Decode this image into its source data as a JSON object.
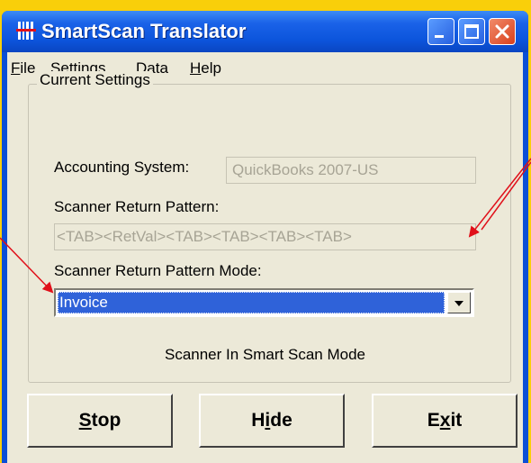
{
  "window": {
    "title": "SmartScan Translator",
    "accent": "#0b4fd6",
    "close_color": "#d9401d"
  },
  "menu": [
    {
      "label": "File",
      "mnemonic": "F",
      "rest": "ile"
    },
    {
      "label": "Settings",
      "pre": "S",
      "mnemonic": "e",
      "rest": "ttings"
    },
    {
      "label": "Data",
      "mnemonic": "D",
      "rest": "ata"
    },
    {
      "label": "Help",
      "mnemonic": "H",
      "rest": "elp"
    }
  ],
  "settings": {
    "group_title": "Current Settings",
    "accounting_label": "Accounting System:",
    "accounting_value": "QuickBooks 2007-US",
    "pattern_label": "Scanner Return Pattern:",
    "pattern_value": "<TAB><RetVal><TAB><TAB><TAB><TAB>",
    "mode_label": "Scanner Return Pattern Mode:",
    "mode_value": "Invoice",
    "status": "Scanner In Smart Scan Mode"
  },
  "buttons": {
    "stop": {
      "mnemonic": "S",
      "rest": "top"
    },
    "hide": {
      "pre": "H",
      "mnemonic": "i",
      "rest": "de"
    },
    "exit": {
      "pre": "E",
      "mnemonic": "x",
      "rest": "it"
    }
  },
  "annotation_color": "#e0101a",
  "icons": [
    "app-icon",
    "minimize-icon",
    "maximize-icon",
    "close-icon",
    "dropdown-arrow-icon"
  ]
}
